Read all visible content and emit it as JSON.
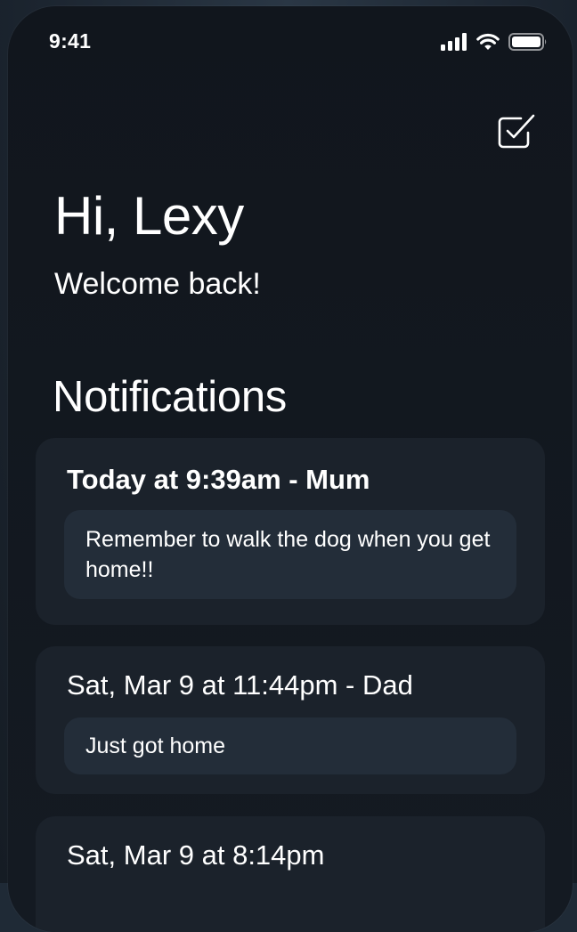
{
  "status_bar": {
    "time": "9:41",
    "icons": [
      "signal-icon",
      "wifi-icon",
      "battery-icon"
    ]
  },
  "header": {
    "compose_icon": "checkbox-edit-icon",
    "greeting": "Hi, Lexy",
    "welcome": "Welcome back!"
  },
  "notifications": {
    "title": "Notifications",
    "items": [
      {
        "header": "Today at 9:39am - Mum",
        "message": "Remember to walk the dog when you get home!!",
        "unread": true
      },
      {
        "header": "Sat, Mar 9 at 11:44pm - Dad",
        "message": "Just got home",
        "unread": false
      },
      {
        "header": "Sat, Mar 9 at 8:14pm",
        "message": "",
        "unread": false
      }
    ]
  },
  "colors": {
    "background": "#11161d",
    "card": "#1b222b",
    "message_bubble": "#232d39",
    "text": "#ffffff"
  }
}
